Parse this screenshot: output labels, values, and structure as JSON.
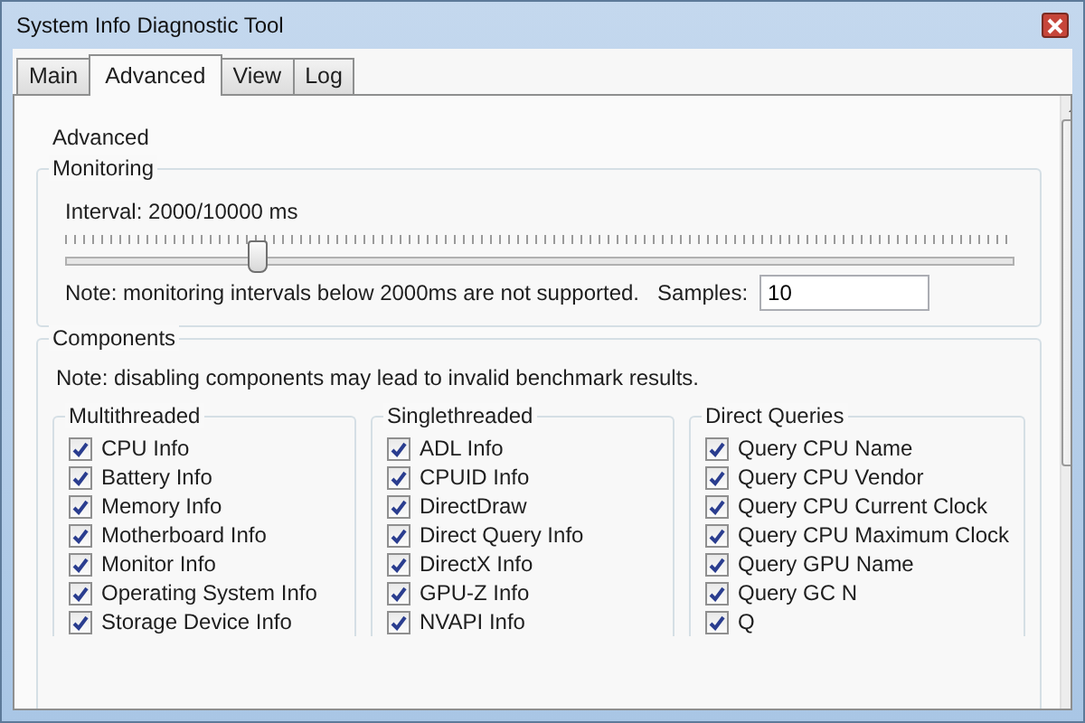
{
  "window": {
    "title": "System Info Diagnostic Tool"
  },
  "tabs": [
    {
      "label": "Main",
      "selected": false
    },
    {
      "label": "Advanced",
      "selected": true
    },
    {
      "label": "View",
      "selected": false
    },
    {
      "label": "Log",
      "selected": false
    }
  ],
  "page_heading": "Advanced",
  "monitoring": {
    "title": "Monitoring",
    "interval_label": "Interval: 2000/10000 ms",
    "level": 0.2,
    "note": "Note: monitoring intervals below 2000ms are not supported.",
    "samples_label": "Samples:",
    "samples_value": "10"
  },
  "components": {
    "title": "Components",
    "note": "Note: disabling components may lead to invalid benchmark results.",
    "groups": [
      {
        "title": "Multithreaded",
        "items": [
          {
            "label": "CPU Info",
            "checked": true
          },
          {
            "label": "Battery Info",
            "checked": true
          },
          {
            "label": "Memory Info",
            "checked": true
          },
          {
            "label": "Motherboard Info",
            "checked": true
          },
          {
            "label": "Monitor Info",
            "checked": true
          },
          {
            "label": "Operating System Info",
            "checked": true
          },
          {
            "label": "Storage Device Info",
            "checked": true
          }
        ]
      },
      {
        "title": "Singlethreaded",
        "items": [
          {
            "label": "ADL Info",
            "checked": true
          },
          {
            "label": "CPUID Info",
            "checked": true
          },
          {
            "label": "DirectDraw",
            "checked": true
          },
          {
            "label": "Direct Query Info",
            "checked": true
          },
          {
            "label": "DirectX Info",
            "checked": true
          },
          {
            "label": "GPU-Z Info",
            "checked": true
          },
          {
            "label": "NVAPI Info",
            "checked": true
          }
        ]
      },
      {
        "title": "Direct Queries",
        "items": [
          {
            "label": "Query CPU Name",
            "checked": true
          },
          {
            "label": "Query CPU Vendor",
            "checked": true
          },
          {
            "label": "Query CPU Current Clock",
            "checked": true
          },
          {
            "label": "Query CPU Maximum Clock",
            "checked": true
          },
          {
            "label": "Query GPU Name",
            "checked": true
          },
          {
            "label": "Query GC N",
            "checked": true
          },
          {
            "label": "Q",
            "checked": true
          }
        ]
      }
    ]
  }
}
